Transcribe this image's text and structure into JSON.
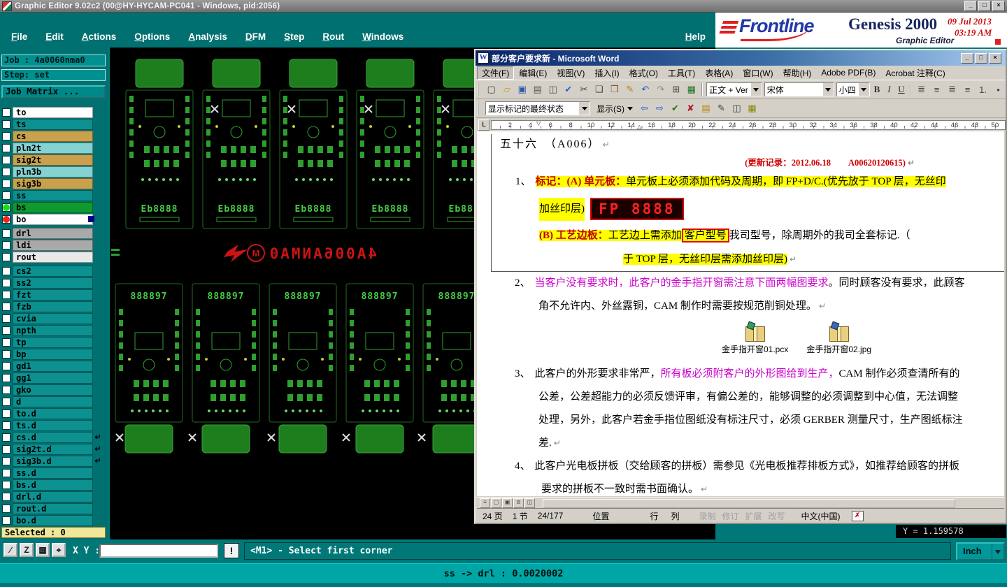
{
  "titlebar": {
    "title": "Graphic Editor 9.02c2 (00@HY-HYCAM-PC041 - Windows, pid:2056)",
    "minimize": "_",
    "maximize": "□",
    "close": "×"
  },
  "menubar": {
    "items": [
      "File",
      "Edit",
      "Actions",
      "Options",
      "Analysis",
      "DFM",
      "Step",
      "Rout",
      "Windows"
    ],
    "help": "Help"
  },
  "brand": {
    "frontline": "Frontline",
    "product": "Genesis 2000",
    "date": "09 Jul 2013",
    "time": "03:19 AM",
    "subtitle": "Graphic Editor"
  },
  "sidebar": {
    "job": "Job : 4a0060nma0",
    "step": "Step: set",
    "matrix_button": "Job Matrix ...",
    "selected": "Selected : 0",
    "layers": [
      {
        "name": "to",
        "bg": "#FFFFFF"
      },
      {
        "name": "ts",
        "bg": "#0D9090"
      },
      {
        "name": "cs",
        "bg": "#C9A14C"
      },
      {
        "name": "pln2t",
        "bg": "#85D2D2"
      },
      {
        "name": "sig2t",
        "bg": "#C9A14C"
      },
      {
        "name": "pln3b",
        "bg": "#85D2D2"
      },
      {
        "name": "sig3b",
        "bg": "#C9A14C"
      },
      {
        "name": "ss",
        "bg": "#0D9090"
      },
      {
        "name": "bs",
        "bg": "#0F9A30",
        "dot": "#18E018"
      },
      {
        "name": "bo",
        "bg": "#FFFFFF",
        "dot": "#FF2020",
        "square": "#000080"
      },
      {
        "name": "drl",
        "bg": "#A9A9A9"
      },
      {
        "name": "ldi",
        "bg": "#A9A9A9"
      },
      {
        "name": "rout",
        "bg": "#E9E9E9"
      },
      {
        "name": "cs2",
        "bg": "#0D9090"
      },
      {
        "name": "ss2",
        "bg": "#0D9090"
      },
      {
        "name": "fzt",
        "bg": "#0D9090"
      },
      {
        "name": "fzb",
        "bg": "#0D9090"
      },
      {
        "name": "cvia",
        "bg": "#0D9090"
      },
      {
        "name": "npth",
        "bg": "#0D9090"
      },
      {
        "name": "tp",
        "bg": "#0D9090"
      },
      {
        "name": "bp",
        "bg": "#0D9090"
      },
      {
        "name": "gd1",
        "bg": "#0D9090"
      },
      {
        "name": "gg1",
        "bg": "#0D9090"
      },
      {
        "name": "gko",
        "bg": "#0D9090"
      },
      {
        "name": "d",
        "bg": "#0D9090"
      },
      {
        "name": "to.d",
        "bg": "#0D9090"
      },
      {
        "name": "ts.d",
        "bg": "#0D9090"
      },
      {
        "name": "cs.d",
        "bg": "#0D9090",
        "arrow": "↵"
      },
      {
        "name": "sig2t.d",
        "bg": "#0D9090",
        "arrow": "↵"
      },
      {
        "name": "sig3b.d",
        "bg": "#0D9090",
        "arrow": "↵"
      },
      {
        "name": "ss.d",
        "bg": "#0D9090"
      },
      {
        "name": "bs.d",
        "bg": "#0D9090"
      },
      {
        "name": "drl.d",
        "bg": "#0D9090"
      },
      {
        "name": "rout.d",
        "bg": "#0D9090"
      },
      {
        "name": "bo.d",
        "bg": "#0D9090"
      }
    ]
  },
  "canvas": {
    "red_text": "4A006ANMA0",
    "emblem_letter": "M",
    "board_label_top": "Eb8888",
    "board_label_bottom": "888897"
  },
  "coords": {
    "y": "Y = 1.159578"
  },
  "bottombar": {
    "icons": [
      {
        "name": "draw-select-icon",
        "glyph": "∕"
      },
      {
        "name": "zoom-icon",
        "glyph": "Z"
      },
      {
        "name": "grid-icon",
        "glyph": "▦"
      },
      {
        "name": "origin-target-icon",
        "glyph": "⌖"
      }
    ],
    "xy_label": "X Y :",
    "xy_value": "",
    "alert_button": "!",
    "message": "<M1> - Select first corner",
    "unit_button": "Inch"
  },
  "ticker": {
    "text": "ss -> drl : 0.0020002"
  },
  "word": {
    "titlebar": {
      "icon": "W",
      "title": "部分客户要求新 - Microsoft Word",
      "minimize": "_",
      "maximize": "□",
      "close": "×"
    },
    "menus": [
      "文件(F)",
      "编辑(E)",
      "视图(V)",
      "插入(I)",
      "格式(O)",
      "工具(T)",
      "表格(A)",
      "窗口(W)",
      "帮助(H)",
      "Adobe PDF(B)",
      "Acrobat 注释(C)"
    ],
    "toolbar1": {
      "icons": [
        {
          "name": "new-doc-icon",
          "glyph": "▢",
          "color": "#444444"
        },
        {
          "name": "open-folder-icon",
          "glyph": "▱",
          "color": "#C8A020"
        },
        {
          "name": "save-icon",
          "glyph": "▣",
          "color": "#3355AA"
        },
        {
          "name": "print-icon",
          "glyph": "▤",
          "color": "#555555"
        },
        {
          "name": "print-preview-icon",
          "glyph": "◫",
          "color": "#555555"
        },
        {
          "name": "spelling-icon",
          "glyph": "✔",
          "color": "#2266CC"
        },
        {
          "name": "cut-icon",
          "glyph": "✂",
          "color": "#444444"
        },
        {
          "name": "copy-icon",
          "glyph": "❏",
          "color": "#444444"
        },
        {
          "name": "paste-icon",
          "glyph": "❒",
          "color": "#885522"
        },
        {
          "name": "format-painter-icon",
          "glyph": "✎",
          "color": "#B8860B"
        },
        {
          "name": "undo-icon",
          "glyph": "↶",
          "color": "#2255CC"
        },
        {
          "name": "redo-icon",
          "glyph": "↷",
          "color": "#888888"
        },
        {
          "name": "table-icon",
          "glyph": "⊞",
          "color": "#444444"
        },
        {
          "name": "excel-icon",
          "glyph": "▦",
          "color": "#207020"
        }
      ],
      "style_combo": "正文 + Ver",
      "font_combo": "宋体",
      "size_combo": "小四",
      "bold": "B",
      "italic": "I",
      "underline": "U",
      "align_icons": [
        {
          "name": "align-justify-icon",
          "glyph": "≣",
          "color": "#444444"
        },
        {
          "name": "align-center-icon",
          "glyph": "≡",
          "color": "#444444"
        },
        {
          "name": "align-right-icon",
          "glyph": "≣",
          "color": "#444444"
        },
        {
          "name": "line-spacing-icon",
          "glyph": "≡",
          "color": "#444444"
        },
        {
          "name": "numbering-icon",
          "glyph": "1.",
          "color": "#444444"
        },
        {
          "name": "bullets-icon",
          "glyph": "•",
          "color": "#444444"
        }
      ]
    },
    "toolbar2": {
      "combo": "显示标记的最终状态",
      "show_button": "显示(S)",
      "icons": [
        {
          "name": "previous-change-icon",
          "glyph": "⇦",
          "color": "#2255CC"
        },
        {
          "name": "next-change-icon",
          "glyph": "⇨",
          "color": "#2255CC"
        },
        {
          "name": "accept-change-icon",
          "glyph": "✔",
          "color": "#207020"
        },
        {
          "name": "reject-change-icon",
          "glyph": "✘",
          "color": "#AA2020"
        },
        {
          "name": "insert-comment-icon",
          "glyph": "▤",
          "color": "#B8860B"
        },
        {
          "name": "track-changes-icon",
          "glyph": "✎",
          "color": "#444444"
        },
        {
          "name": "reviewing-pane-icon",
          "glyph": "◫",
          "color": "#444444"
        },
        {
          "name": "highlight-icon",
          "glyph": "▦",
          "color": "#888800"
        }
      ]
    },
    "ruler": {
      "tab_glyph": "L",
      "indent_marker": "▽",
      "hanging_marker": "△",
      "numbers": [
        "2",
        "4",
        "6",
        "8",
        "10",
        "12",
        "14",
        "16",
        "18",
        "20",
        "22",
        "24",
        "26",
        "28",
        "30",
        "32",
        "34",
        "36",
        "38",
        "40",
        "42",
        "44",
        "46",
        "48",
        "50"
      ]
    },
    "doc": {
      "pilcrow": "↵",
      "heading": "五十六　（A006）",
      "update_note": "(更新记录：2012.06.18　　A00620120615)",
      "item1_no": "1、",
      "item1_label": "标记：(A) 单元板：",
      "item1_text": "单元板上必须添加代码及周期，即 FP+D/C.(优先放于 TOP 层，无丝印",
      "item1_line2": "加丝印层)",
      "fp_code": "FP 8888",
      "item1b_label": "(B) 工艺边板：",
      "item1b_text1": "工艺边上需添加",
      "item1b_boxed": "客户型号",
      "item1b_text2": "我司型号，除周期外的我司全套标记.（",
      "item1b_line2": "于 TOP 层，无丝印层需添加丝印层)",
      "item2_no": "2、",
      "item2_colored": "当客户没有要求时，此客户的金手指开窗需注意下面两幅图要求",
      "item2_rest": "。同时顾客没有要求，此顾客",
      "item2_line2": "角不允许内、外丝露铜，CAM 制作时需要按规范削铜处理。",
      "attachments": [
        {
          "label": "金手指开窗01.pcx",
          "gem": "#2FA060"
        },
        {
          "label": "金手指开窗02.jpg",
          "gem": "#3A64C8"
        }
      ],
      "item3_no": "3、",
      "item3_text1": "此客户的外形要求非常严，",
      "item3_colored": "所有板必须附客户的外形图给到生产，",
      "item3_text2": "CAM 制作必须查清所有的",
      "item3_line2": "公差，公差超能力的必须反馈评审，有偏公差的，能够调整的必须调整到中心值，无法调整",
      "item3_line3": "处理，另外，此客户若金手指位图纸没有标注尺寸，必须 GERBER 测量尺寸，生产图纸标注",
      "item3_line4": "差.",
      "item4_no": "4、",
      "item4_line1": "此客户光电板拼板（交给顾客的拼板）需参见《光电板推荐排板方式》，如推荐给顾客的拼板",
      "item4_line2": "要求的拼板不一致时需书面确认。"
    },
    "viewbar_icons": [
      {
        "name": "normal-view-icon",
        "glyph": "≡"
      },
      {
        "name": "web-layout-icon",
        "glyph": "▢"
      },
      {
        "name": "print-layout-icon",
        "glyph": "▣"
      },
      {
        "name": "outline-view-icon",
        "glyph": "≣"
      },
      {
        "name": "reading-layout-icon",
        "glyph": "◫"
      }
    ],
    "statusbar": {
      "page": "24 页",
      "section": "1 节",
      "position": "24/177",
      "location": "位置",
      "line": "行",
      "column": "列",
      "record": "录制",
      "track": "修订",
      "extend": "扩展",
      "overtype": "改写",
      "language": "中文(中国)",
      "proof_glyph": "✗"
    }
  }
}
